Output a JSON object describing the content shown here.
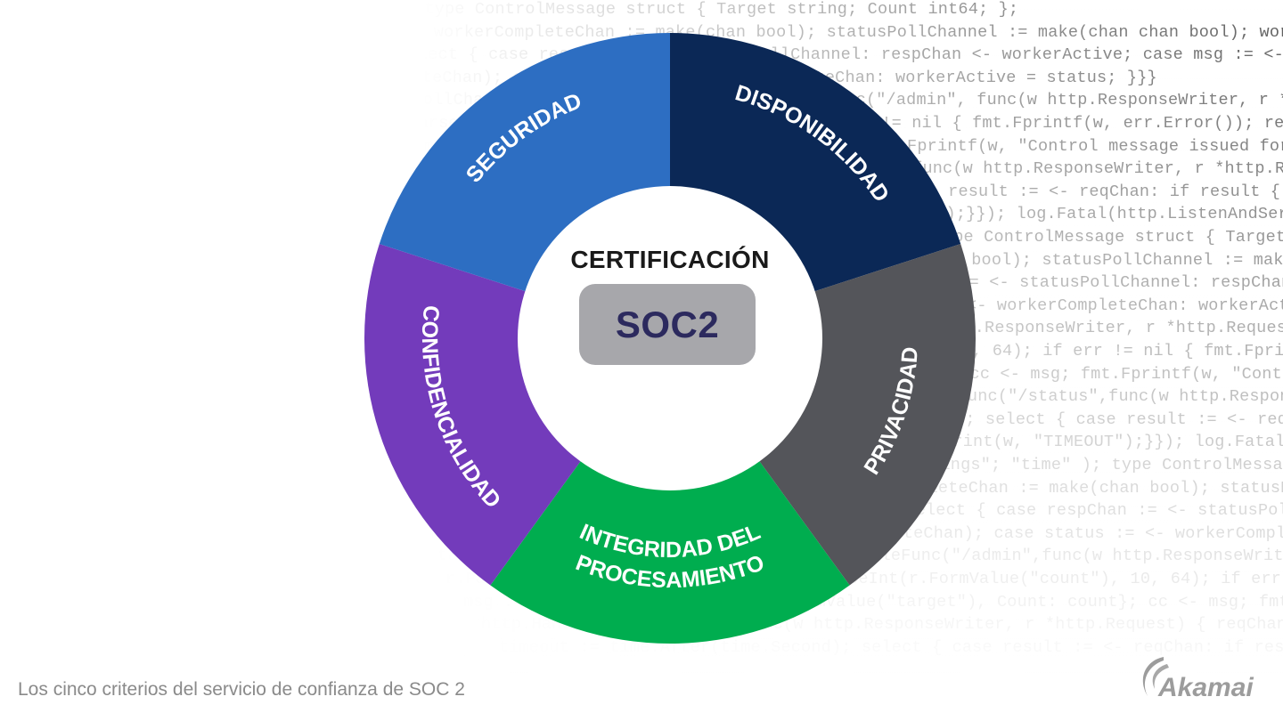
{
  "background_code": [
    "package main; import ( \"fmt\"; \"strings\"; \"time\" ); type ControlMessage struct { Target string; Count int64; };",
    "func main() { controlChannel := make(chan ControlMessage); workerCompleteChan := make(chan bool); statusPollChannel := make(chan chan bool); workerActive := false;",
    "go admin(controlChannel, statusPollChannel); for { select { case respChan := <- statusPollChannel: respChan <- workerActive; case msg := <-controlChannel:",
    "workerActive = true; go doStuff(msg, workerCompleteChan); case status := <- workerCompleteChan: workerActive = status; }}}",
    "func admin(cc chan ControlMessage, statusPollChannel chan chan bool) { http.HandleFunc(\"/admin\", func(w http.ResponseWriter, r *http.Request) { hostTokens := strings.Split(r.Host, \":\");",
    "r.ParseForm(); count, err := strconv.ParseInt(r.FormValue(\"count\"), 10, 64); if err != nil { fmt.Fprintf(w, err.Error()); return; };",
    "msg := ControlMessage{Target: r.FormValue(\"target\"), Count: count}; cc <- msg; fmt.Fprintf(w, \"Control message issued for Target %s, count %d\",",
    "html.EscapeString(r.FormValue(\"target\")), count); }); http.HandleFunc(\"/status\",func(w http.ResponseWriter, r *http.Request) { reqChan := make(chan bool);",
    "statusPollChannel <- reqChan; timeout := time.After(time.Second); select { case result := <- reqChan: if result { fmt.Fprint(w, \"ACTIVE\"); } else {",
    "fmt.Fprint(w, \"INACTIVE\"); }; return; case <- timeout: fmt.Fprint(w, \"TIMEOUT\");}}); log.Fatal(http.ListenAndServe(\":1337\", nil)); };package main;",
    "import ( \"fmt\"; \"html\"; \"log\"; \"net/http\"; \"strconv\"; \"strings\"; \"time\" ); type ControlMessage struct { Target string; Count int64; }; func main() {",
    "controlChannel := make(chan ControlMessage); workerCompleteChan := make(chan bool); statusPollChannel := make(chan chan bool); workerActive := false;",
    "go admin(controlChannel, statusPollChannel); for { select { case respChan := <- statusPollChannel: respChan <- workerActive; case msg := <-controlChannel:",
    "workerActive = true; go doStuff(msg, workerCompleteChan); case status := <- workerCompleteChan: workerActive = status; }}}; func admin(cc chan ControlMessage,",
    "statusPollChannel chan chan bool) { http.HandleFunc(\"/admin\",func(w http.ResponseWriter, r *http.Request) { hostTokens := strings.Split(r.Host, \":\");",
    "r.ParseForm(); count, err := strconv.ParseInt(r.FormValue(\"count\"), 10, 64); if err != nil { fmt.Fprintf(w, err.Error()); return; };",
    "msg := ControlMessage{Target: r.FormValue(\"target\"), Count: count}; cc <- msg; fmt.Fprintf(w, \"Control message issued for Target %s\",",
    "html.EscapeString(r.FormValue(\"target\")), count); }); http.HandleFunc(\"/status\",func(w http.ResponseWriter, r *http.Request) { reqChan := make(chan bool);",
    "statusPollChannel <- reqChan; timeout := time.After(time.Second); select { case result := <- reqChan: if result { fmt.Fprint(w, \"ACTIVE\"); } else {",
    "fmt.Fprint(w, \"INACTIVE\"); }; return; case <- timeout: fmt.Fprint(w, \"TIMEOUT\");}}); log.Fatal(http.ListenAndServe(\":1337\", nil)); };package main;",
    "import ( \"fmt\"; \"html\"; \"log\"; \"net/http\"; \"strconv\"; \"strings\"; \"time\" ); type ControlMessage struct { Target string; Count int64; }; func main() {",
    "controlChannel := make(chan ControlMessage); workerCompleteChan := make(chan bool); statusPollChannel := make(chan chan bool); workerActive := false;",
    "go admin(controlChannel, statusPollChannel); for { select { case respChan := <- statusPollChannel: respChan <- workerActive; case msg := <-controlChannel:",
    "workerActive = true; go doStuff(msg, workerCompleteChan); case status := <- workerCompleteChan: workerActive = status; }}}; func admin(cc chan ControlMessage,",
    "statusPollChannel chan chan bool) { http.HandleFunc(\"/admin\",func(w http.ResponseWriter, r *http.Request) { hostTokens := strings.Split(r.Host, \":\");",
    "r.ParseForm(); count, err := strconv.ParseInt(r.FormValue(\"count\"), 10, 64); if err != nil { fmt.Fprintf(w, err.Error()); return; };",
    "msg := ControlMessage{Target: r.FormValue(\"target\"), Count: count}; cc <- msg; fmt.Fprintf(w, \"Control message issued\", count); });",
    "http.HandleFunc(\"/status\",func(w http.ResponseWriter, r *http.Request) { reqChan := make(chan bool); statusPollChannel <- reqChan;",
    "timeout := time.After(time.Second); select { case result := <- reqChan: if result { fmt.Fprint(w, \"ACTIVE\"); } else { fmt.Fprint(w, \"INACTIVE\"); };"
  ],
  "diagram": {
    "center_title": "CERTIFICACIÓN",
    "center_badge": "SOC2",
    "badge_color": "#a7a7ab",
    "segments": [
      {
        "label": "DISPONIBILIDAD",
        "color": "#0b2856"
      },
      {
        "label": "PRIVACIDAD",
        "color": "#54555a"
      },
      {
        "label_lines": [
          "INTEGRIDAD DEL",
          "PROCESAMIENTO"
        ],
        "label": "INTEGRIDAD DEL PROCESAMIENTO",
        "color": "#00ad4f"
      },
      {
        "label": "CONFIDENCIALIDAD",
        "color": "#733bbb"
      },
      {
        "label": "SEGURIDAD",
        "color": "#2d6ec2"
      }
    ]
  },
  "caption": "Los cinco criterios del servicio de confianza de SOC 2",
  "logo": {
    "text": "Akamai",
    "icon": "akamai-wave-icon"
  }
}
